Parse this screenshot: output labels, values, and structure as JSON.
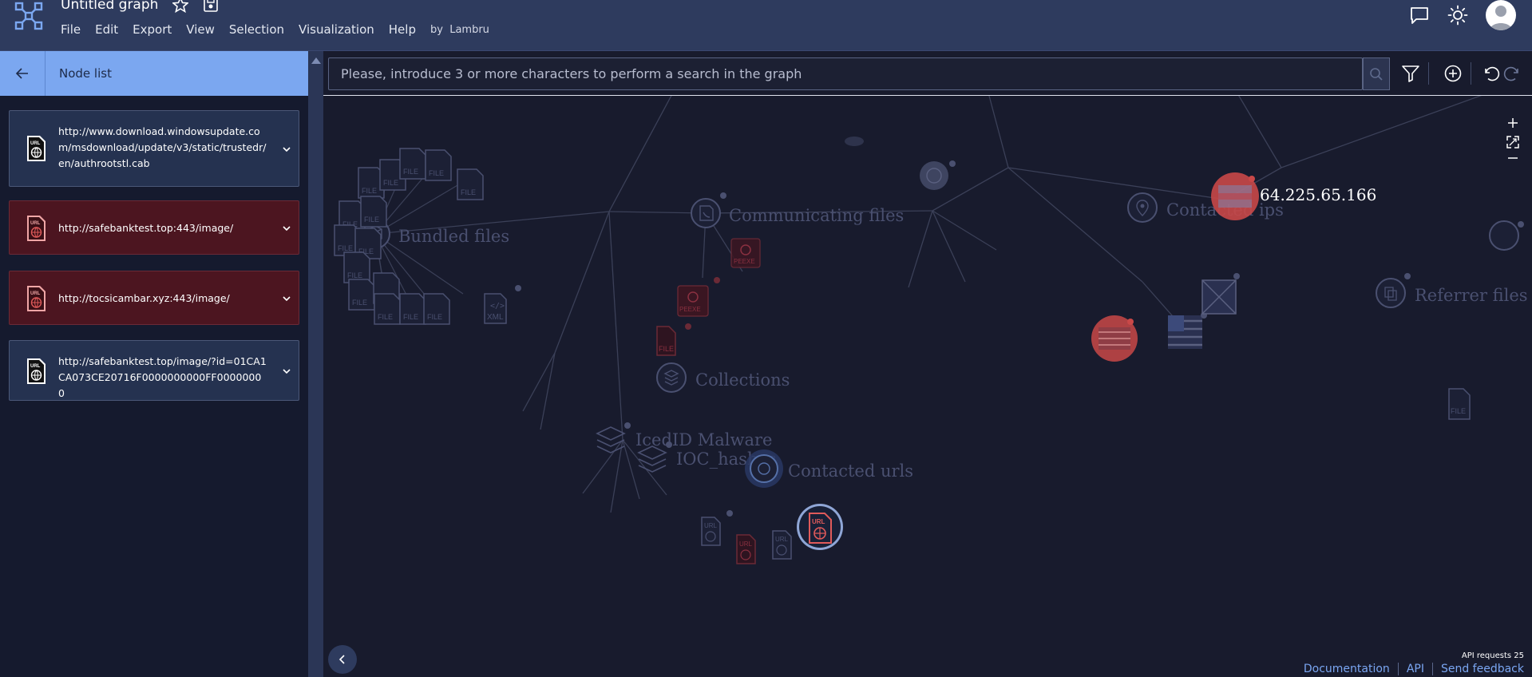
{
  "header": {
    "graph_title": "Untitled graph",
    "menu": [
      "File",
      "Edit",
      "Export",
      "View",
      "Selection",
      "Visualization",
      "Help"
    ],
    "by_label": "by",
    "author": "Lambru"
  },
  "sidebar": {
    "title": "Node list",
    "nodes": [
      {
        "url": "http://www.download.windowsupdate.com/msdownload/update/v3/static/trustedr/en/authrootstl.cab",
        "status": "normal",
        "icon": "url-file-icon"
      },
      {
        "url": "http://safebanktest.top:443/image/",
        "status": "malicious",
        "icon": "url-file-icon"
      },
      {
        "url": "http://tocsicambar.xyz:443/image/",
        "status": "malicious",
        "icon": "url-file-icon"
      },
      {
        "url": "http://safebanktest.top/image/?id=01CA1CA073CE20716F0000000000FF00000000",
        "status": "normal",
        "icon": "url-file-icon"
      }
    ]
  },
  "search": {
    "placeholder": "Please, introduce 3 or more characters to perform a search in the graph"
  },
  "graph": {
    "groups": [
      "Bundled files",
      "Communicating files",
      "Contacted ips",
      "Referrer files",
      "Collections",
      "IcedID Malware",
      "IOC_hashes",
      "Contacted urls"
    ],
    "ip_label": "64.225.65.166",
    "file_badge": "FILE",
    "xml_badge": "XML",
    "peexe_badge": "PEEXE",
    "url_badge": "URL"
  },
  "footer": {
    "api_requests": "API requests 25",
    "links": [
      "Documentation",
      "API",
      "Send feedback"
    ]
  },
  "colors": {
    "topbar": "#2e3b5e",
    "sidebar_head": "#7ba7f0",
    "canvas": "#181b2d",
    "danger": "#e05a5a",
    "link": "#7aa6f2"
  }
}
